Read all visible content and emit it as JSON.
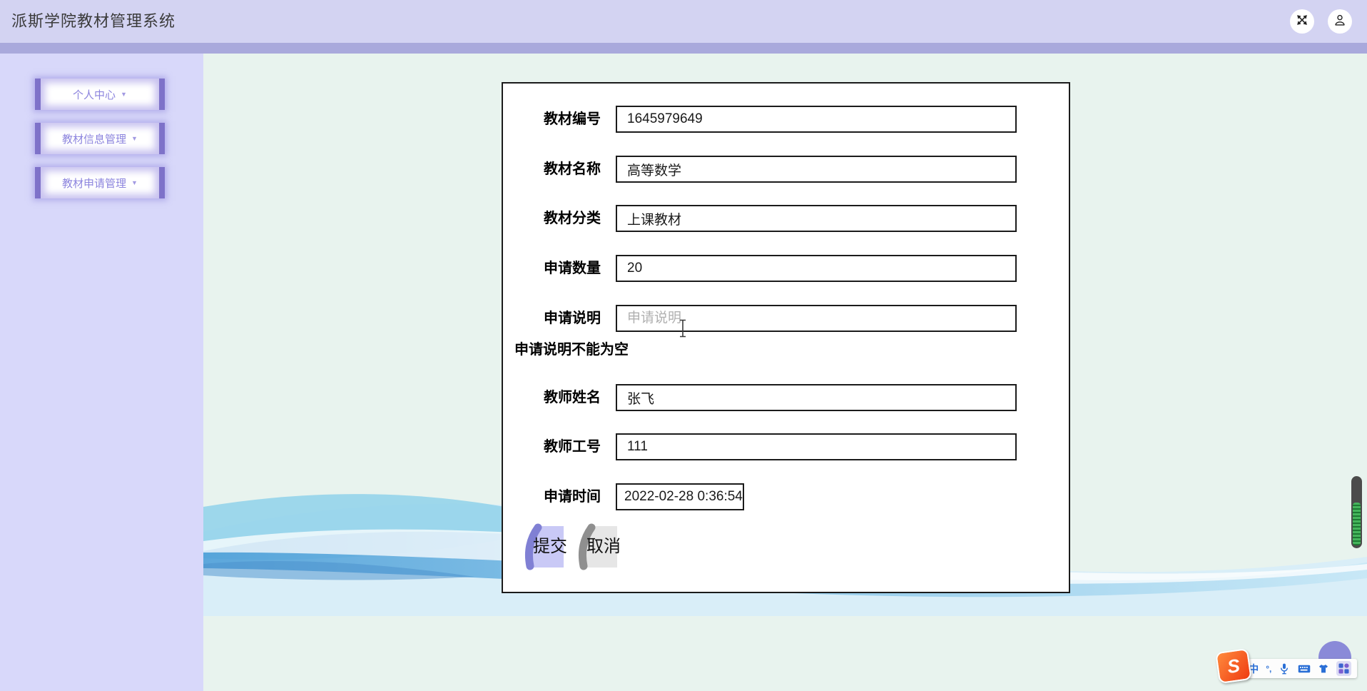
{
  "header": {
    "title": "派斯学院教材管理系统"
  },
  "sidebar": {
    "caret": "▼",
    "items": [
      {
        "label": "个人中心"
      },
      {
        "label": "教材信息管理"
      },
      {
        "label": "教材申请管理"
      }
    ]
  },
  "form": {
    "rows": [
      {
        "label": "教材编号",
        "value": "1645979649"
      },
      {
        "label": "教材名称",
        "value": "高等数学"
      },
      {
        "label": "教材分类",
        "value": "上课教材"
      },
      {
        "label": "申请数量",
        "value": "20"
      },
      {
        "label": "申请说明",
        "value": "",
        "placeholder": "申请说明"
      },
      {
        "label": "教师姓名",
        "value": "张飞"
      },
      {
        "label": "教师工号",
        "value": "111"
      },
      {
        "label": "申请时间",
        "value": "2022-02-28 0:36:54"
      }
    ],
    "error": "申请说明不能为空",
    "submit_label": "提交",
    "cancel_label": "取消"
  },
  "ime": {
    "logo": "S",
    "lang_label": "中",
    "punct_label": "°,"
  },
  "colors": {
    "header_bg": "#d3d3f2",
    "divider": "#a9a9dc",
    "sidebar_bg": "#d8d8fa",
    "main_bg": "#e8f3ee",
    "accent_purple": "#7e72c9",
    "submit_fill": "#c9c9f6",
    "submit_arc": "#8080d4",
    "cancel_fill": "#e6e6e6",
    "cancel_arc": "#8f8f8f",
    "ime_blue": "#2a6fd6",
    "ime_orange": "#ef3b11"
  }
}
